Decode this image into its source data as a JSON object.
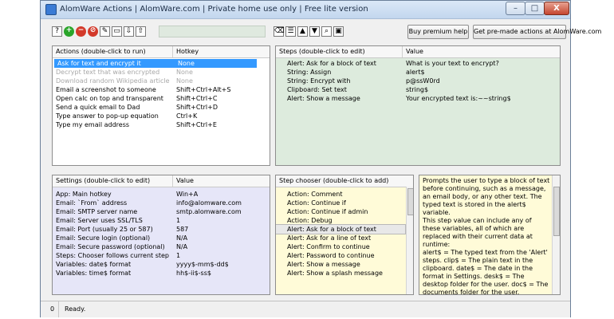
{
  "window": {
    "title": "AlomWare Actions  |  AlomWare.com  |  Private home use only  |  Free lite version",
    "min_label": "–",
    "max_label": "□",
    "close_label": "X"
  },
  "toolbar": {
    "left_icons": [
      {
        "name": "help-icon",
        "glyph": "?"
      },
      {
        "name": "add-icon",
        "glyph": "+"
      },
      {
        "name": "remove-icon",
        "glyph": "−"
      },
      {
        "name": "disable-icon",
        "glyph": "⊘"
      },
      {
        "name": "edit-icon",
        "glyph": "✎"
      },
      {
        "name": "blank-page-icon",
        "glyph": "▭"
      },
      {
        "name": "export-icon",
        "glyph": "⇩"
      },
      {
        "name": "import-icon",
        "glyph": "⇧"
      }
    ],
    "right_icons": [
      {
        "name": "eraser-icon",
        "glyph": "⌫"
      },
      {
        "name": "list-icon",
        "glyph": "☰"
      },
      {
        "name": "move-up-icon",
        "glyph": "▲"
      },
      {
        "name": "move-down-icon",
        "glyph": "▼"
      },
      {
        "name": "search-icon",
        "glyph": "⌕"
      },
      {
        "name": "folder-icon",
        "glyph": "▣"
      }
    ],
    "buy_label": "Buy premium help",
    "premade_label": "Get pre-made actions at AlomWare.com"
  },
  "actions": {
    "col1": "Actions  (double-click to run)",
    "col2": "Hotkey",
    "rows": [
      {
        "name": "Ask for text and encrypt it",
        "hotkey": "None",
        "state": "selected"
      },
      {
        "name": "Decrypt text that was encrypted",
        "hotkey": "None",
        "state": "dimmed"
      },
      {
        "name": "Download random Wikipedia article",
        "hotkey": "None",
        "state": "dimmed"
      },
      {
        "name": "Email a screenshot to someone",
        "hotkey": "Shift+Ctrl+Alt+S",
        "state": "normal"
      },
      {
        "name": "Open calc on top and transparent",
        "hotkey": "Shift+Ctrl+C",
        "state": "normal"
      },
      {
        "name": "Send a quick email to Dad",
        "hotkey": "Shift+Ctrl+D",
        "state": "normal"
      },
      {
        "name": "Type answer to pop-up equation",
        "hotkey": "Ctrl+K",
        "state": "normal"
      },
      {
        "name": "Type my email address",
        "hotkey": "Shift+Ctrl+E",
        "state": "normal"
      }
    ]
  },
  "steps": {
    "col1": "Steps  (double-click to edit)",
    "col2": "Value",
    "rows": [
      {
        "icon": "alert-icon",
        "glyph": "!",
        "color": "#e8a000",
        "name": "Alert: Ask for a block of text",
        "value": "What is your text to encrypt?"
      },
      {
        "icon": "string-assign-icon",
        "glyph": "a",
        "color": "#555555",
        "name": "String: Assign",
        "value": "alert$"
      },
      {
        "icon": "string-encrypt-icon",
        "glyph": "a",
        "color": "#555555",
        "name": "String: Encrypt with",
        "value": "p@ssW0rd"
      },
      {
        "icon": "clipboard-icon",
        "glyph": "▤",
        "color": "#b07a2a",
        "name": "Clipboard: Set text",
        "value": "string$"
      },
      {
        "icon": "alert-icon",
        "glyph": "!",
        "color": "#e8a000",
        "name": "Alert: Show a message",
        "value": "Your encrypted text is:~~string$"
      }
    ]
  },
  "settings": {
    "col1": "Settings  (double-click to edit)",
    "col2": "Value",
    "rows": [
      {
        "name": "App: Main hotkey",
        "value": "Win+A"
      },
      {
        "name": "Email: `From` address",
        "value": "info@alomware.com"
      },
      {
        "name": "Email: SMTP server name",
        "value": "smtp.alomware.com"
      },
      {
        "name": "Email: Server uses SSL/TLS",
        "value": "1"
      },
      {
        "name": "Email: Port (usually 25 or 587)",
        "value": "587"
      },
      {
        "name": "Email: Secure login (optional)",
        "value": "N/A"
      },
      {
        "name": "Email: Secure password (optional)",
        "value": "N/A"
      },
      {
        "name": "Steps: Chooser follows current step",
        "value": "1"
      },
      {
        "name": "Variables: date$ format",
        "value": "yyyy$-mm$-dd$"
      },
      {
        "name": "Variables: time$ format",
        "value": "hh$-ii$-ss$"
      }
    ]
  },
  "chooser": {
    "col1": "Step chooser  (double-click to add)",
    "rows": [
      {
        "icon": "action-icon",
        "glyph": "➶",
        "color": "#2a7ad5",
        "name": "Action: Comment",
        "state": "normal"
      },
      {
        "icon": "action-icon",
        "glyph": "➶",
        "color": "#2a7ad5",
        "name": "Action: Continue if",
        "state": "normal"
      },
      {
        "icon": "action-icon",
        "glyph": "➶",
        "color": "#2a7ad5",
        "name": "Action: Continue if admin",
        "state": "normal"
      },
      {
        "icon": "action-icon",
        "glyph": "➶",
        "color": "#2a7ad5",
        "name": "Action: Debug",
        "state": "normal"
      },
      {
        "icon": "alert-icon",
        "glyph": "!",
        "color": "#e8a000",
        "name": "Alert: Ask for a block of text",
        "state": "highlighted"
      },
      {
        "icon": "alert-icon",
        "glyph": "!",
        "color": "#e8a000",
        "name": "Alert: Ask for a line of text",
        "state": "normal"
      },
      {
        "icon": "alert-icon",
        "glyph": "!",
        "color": "#e8a000",
        "name": "Alert: Confirm to continue",
        "state": "normal"
      },
      {
        "icon": "alert-icon",
        "glyph": "!",
        "color": "#e8a000",
        "name": "Alert: Password to continue",
        "state": "normal"
      },
      {
        "icon": "alert-icon",
        "glyph": "!",
        "color": "#e8a000",
        "name": "Alert: Show a message",
        "state": "normal"
      },
      {
        "icon": "alert-icon",
        "glyph": "!",
        "color": "#e8a000",
        "name": "Alert: Show a splash message",
        "state": "normal"
      }
    ]
  },
  "help": {
    "p1": "Prompts the user to type a block of text before continuing, such as a message, an email body, or any other text. The typed text is stored in the alert$ variable.",
    "p2": "This step value can include any of these variables, all of which are replaced with their current data at runtime:",
    "p3": "alert$ = The typed text from the 'Alert' steps. clip$ = The plain text in the clipboard. date$ = The date in the format in Settings. desk$ = The desktop folder for the user. doc$ = The documents folder for the user."
  },
  "status": {
    "count": "0",
    "text": "Ready."
  },
  "colors": {
    "steps_bg": "#ddebdd",
    "settings_bg": "#e6e6f8",
    "chooser_bg": "#fffbd8",
    "selection": "#3399ff"
  }
}
